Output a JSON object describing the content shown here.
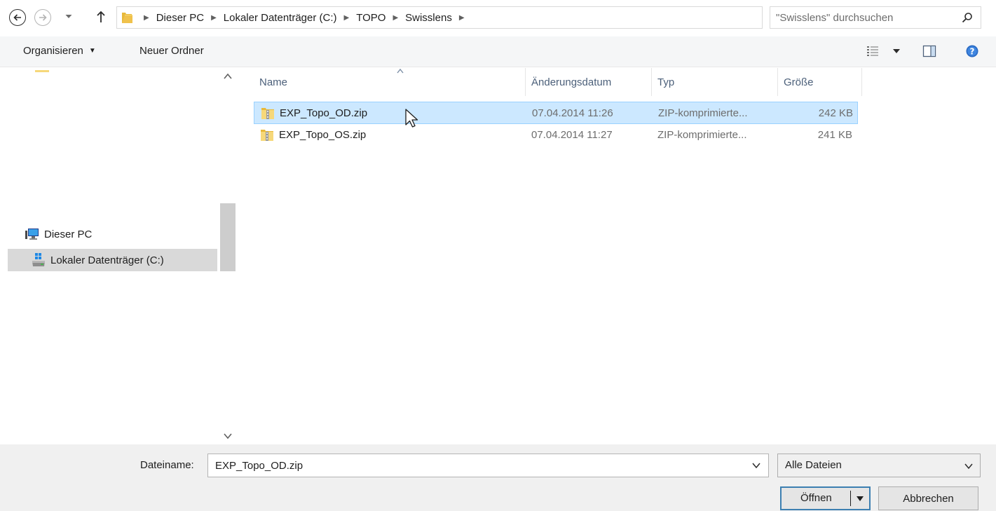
{
  "address_bar": {
    "breadcrumbs": [
      "Dieser PC",
      "Lokaler Datenträger (C:)",
      "TOPO",
      "Swisslens"
    ],
    "search_placeholder": "\"Swisslens\" durchsuchen",
    "icons": [
      "back-arrow-icon",
      "forward-arrow-icon",
      "chevron-down-icon",
      "up-arrow-icon",
      "folder-icon",
      "refresh-icon",
      "search-icon"
    ]
  },
  "command_bar": {
    "organize_label": "Organisieren",
    "new_folder_label": "Neuer Ordner",
    "icons": [
      "view-options-icon",
      "preview-pane-icon",
      "help-icon"
    ]
  },
  "nav_pane": {
    "items": [
      {
        "label": "Dieser PC",
        "icon": "computer-icon",
        "selected": false
      },
      {
        "label": "Lokaler Datenträger (C:)",
        "icon": "drive-icon",
        "selected": true
      }
    ]
  },
  "file_list": {
    "columns": [
      "Name",
      "Änderungsdatum",
      "Typ",
      "Größe"
    ],
    "rows": [
      {
        "name": "EXP_Topo_OD.zip",
        "date": "07.04.2014 11:26",
        "type": "ZIP-komprimierte...",
        "size": "242 KB",
        "selected": true
      },
      {
        "name": "EXP_Topo_OS.zip",
        "date": "07.04.2014 11:27",
        "type": "ZIP-komprimierte...",
        "size": "241 KB",
        "selected": false
      }
    ]
  },
  "footer": {
    "filename_label": "Dateiname:",
    "filename_value": "EXP_Topo_OD.zip",
    "filetype_value": "Alle Dateien",
    "open_label": "Öffnen",
    "cancel_label": "Abbrechen"
  },
  "colors": {
    "selection_bg": "#cce8ff",
    "selection_border": "#99d1ff",
    "column_header": "#4c607a",
    "primary_button_border": "#3c7fb1"
  }
}
